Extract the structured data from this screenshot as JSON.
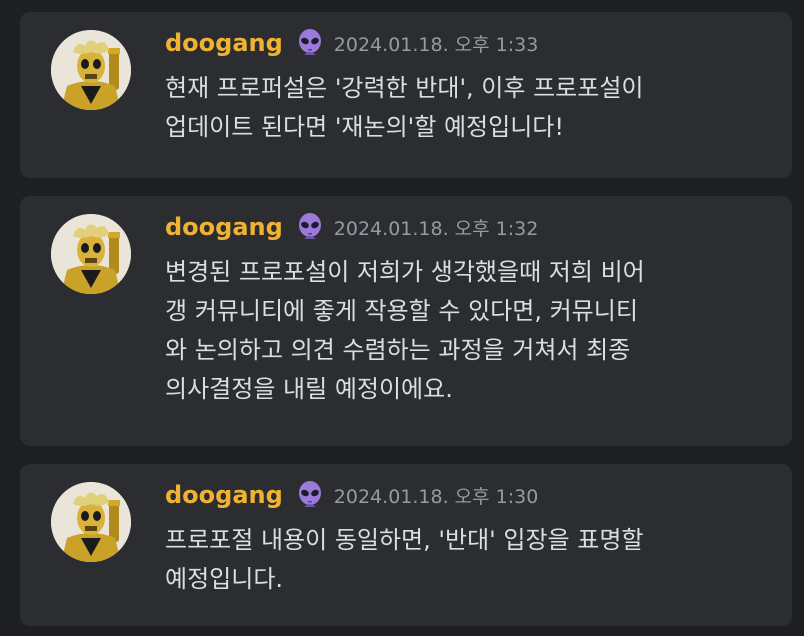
{
  "messages": [
    {
      "author": "doogang",
      "author_badge_icon": "alien-emoji-icon",
      "timestamp": "2024.01.18. 오후 1:33",
      "lines": [
        "현재 프로퍼설은 '강력한 반대', 이후 프로포설이",
        "업데이트 된다면 '재논의'할 예정입니다!"
      ]
    },
    {
      "author": "doogang",
      "author_badge_icon": "alien-emoji-icon",
      "timestamp": "2024.01.18. 오후 1:32",
      "lines": [
        "변경된 프로포설이 저희가 생각했을때 저희 비어",
        "갱 커뮤니티에 좋게 작용할 수 있다면, 커뮤니티",
        "와 논의하고 의견 수렴하는 과정을 거쳐서 최종",
        "의사결정을 내릴 예정이에요."
      ]
    },
    {
      "author": "doogang",
      "author_badge_icon": "alien-emoji-icon",
      "timestamp": "2024.01.18. 오후 1:30",
      "lines": [
        "프로포절 내용이 동일하면, '반대' 입장을 표명할",
        "예정입니다."
      ]
    }
  ],
  "colors": {
    "background": "#1e1f22",
    "card": "#2b2d31",
    "username": "#f0b232",
    "timestamp": "#949ba4",
    "text": "#dbdee1"
  }
}
